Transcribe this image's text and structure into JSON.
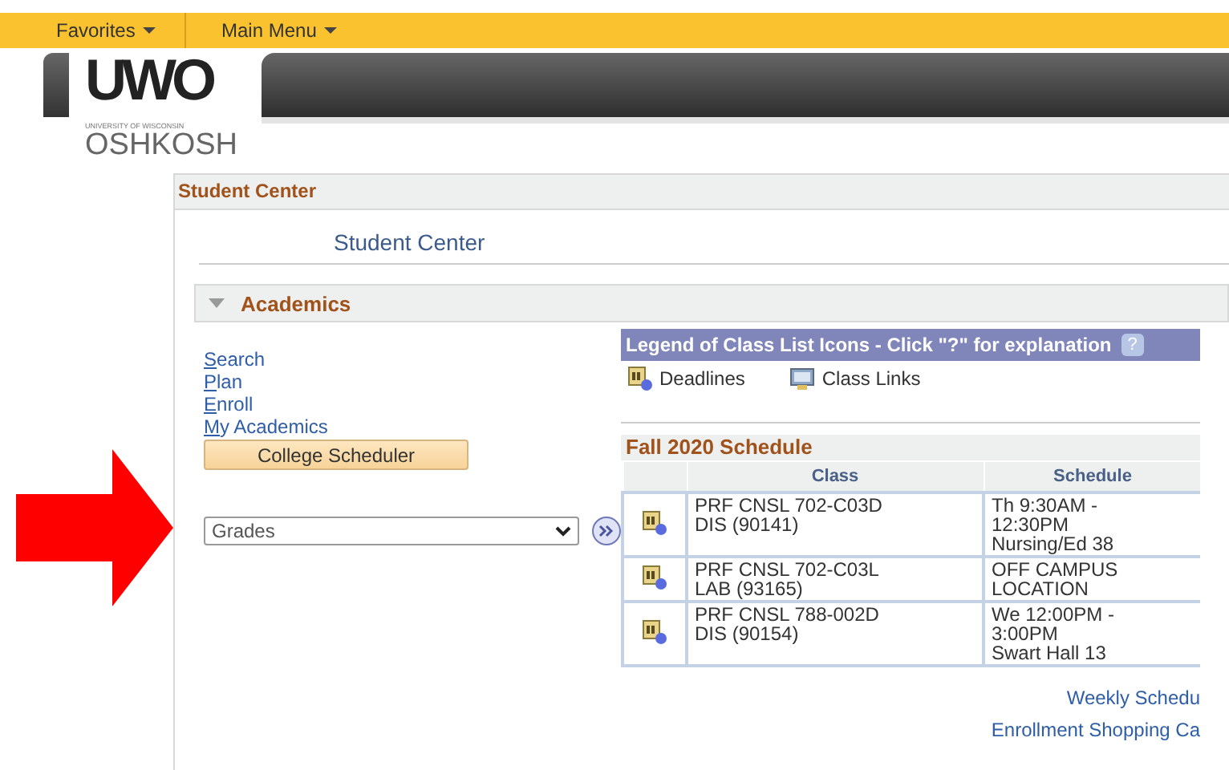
{
  "menu_bar": {
    "items": [
      {
        "label": "Favorites"
      },
      {
        "label": "Main Menu"
      }
    ]
  },
  "logo": {
    "mark": "UWO",
    "line_1": "UNIVERSITY OF WISCONSIN",
    "line_2": "OSHKOSH"
  },
  "panel": {
    "title": "Student Center",
    "heading": "Student Center",
    "section": {
      "title": "Academics",
      "expanded": true
    },
    "links": [
      {
        "key": "S",
        "rest": "earch"
      },
      {
        "key": "P",
        "rest": "lan"
      },
      {
        "key": "E",
        "rest": "nroll"
      },
      {
        "key": "M",
        "rest": "y Academics"
      }
    ],
    "button": "College Scheduler",
    "dropdown": {
      "value": "Grades"
    },
    "legend": {
      "title": "Legend of Class List Icons - Click \"?\" for explanation",
      "help": "?",
      "items": [
        {
          "kind": "deadlines",
          "label": "Deadlines"
        },
        {
          "kind": "class_links",
          "label": "Class Links"
        }
      ]
    },
    "schedule": {
      "title": "Fall 2020 Schedule",
      "columns": [
        "Class",
        "Schedule"
      ],
      "rows": [
        {
          "class": [
            "PRF CNSL 702-C03D",
            "DIS (90141)"
          ],
          "schedule": [
            "Th 9:30AM -",
            "12:30PM",
            "Nursing/Ed 38"
          ]
        },
        {
          "class": [
            "PRF CNSL 702-C03L",
            "LAB (93165)"
          ],
          "schedule": [
            "OFF CAMPUS",
            "LOCATION"
          ]
        },
        {
          "class": [
            "PRF CNSL 788-002D",
            "DIS (90154)"
          ],
          "schedule": [
            "We 12:00PM -",
            "3:00PM",
            "Swart Hall 13"
          ]
        }
      ]
    },
    "bottom_links": [
      "Weekly Schedu",
      "Enrollment Shopping Ca"
    ]
  }
}
